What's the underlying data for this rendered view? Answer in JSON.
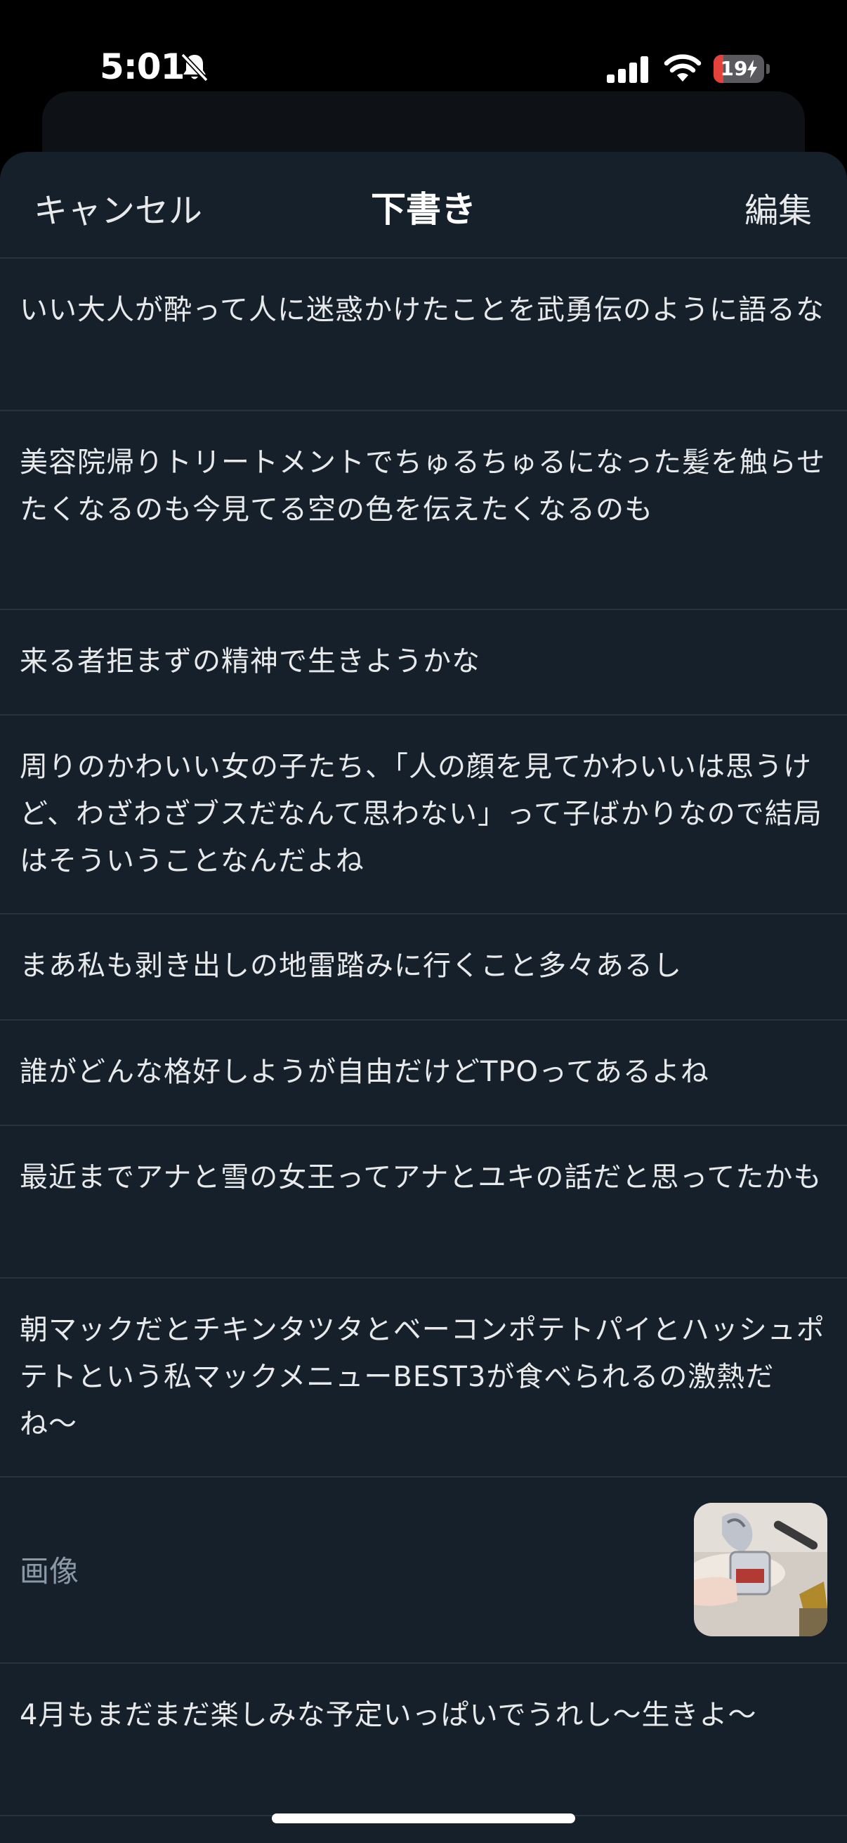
{
  "status_bar": {
    "time": "5:01",
    "battery_level": "19",
    "battery_fraction": 0.19,
    "battery_color": "#e5423b",
    "icons": [
      "bell-slash-icon",
      "signal-icon",
      "wifi-icon",
      "charging-bolt-icon"
    ]
  },
  "nav": {
    "cancel_label": "キャンセル",
    "title": "下書き",
    "edit_label": "編集"
  },
  "drafts": [
    {
      "text": "いい大人が酔って人に迷惑かけたことを武勇伝のように語るな"
    },
    {
      "text": "美容院帰りトリートメントでちゅるちゅるになった髪を触らせたくなるのも今見てる空の色を伝えたくなるのも"
    },
    {
      "text": "来る者拒まずの精神で生きようかな"
    },
    {
      "text": "周りのかわいい女の子たち、「人の顔を見てかわいいは思うけど、わざわざブスだなんて思わない」って子ばかりなので結局はそういうことなんだよね"
    },
    {
      "text": "まあ私も剥き出しの地雷踏みに行くこと多々あるし"
    },
    {
      "text": "誰がどんな格好しようが自由だけどTPOってあるよね"
    },
    {
      "text": "最近までアナと雪の女王ってアナとユキの話だと思ってたかも"
    },
    {
      "text": "朝マックだとチキンタツタとベーコンポテトパイとハッシュポテトという私マックメニューBEST3が食べられるの激熱だね〜"
    },
    {
      "media_label": "画像"
    },
    {
      "text": "4月もまだまだ楽しみな予定いっぱいでうれし〜生きよ〜"
    }
  ],
  "colors": {
    "sheet_background": "#15202b",
    "separator": "#263340",
    "text_primary": "#e7e9ea",
    "text_secondary": "#8b98a5"
  }
}
